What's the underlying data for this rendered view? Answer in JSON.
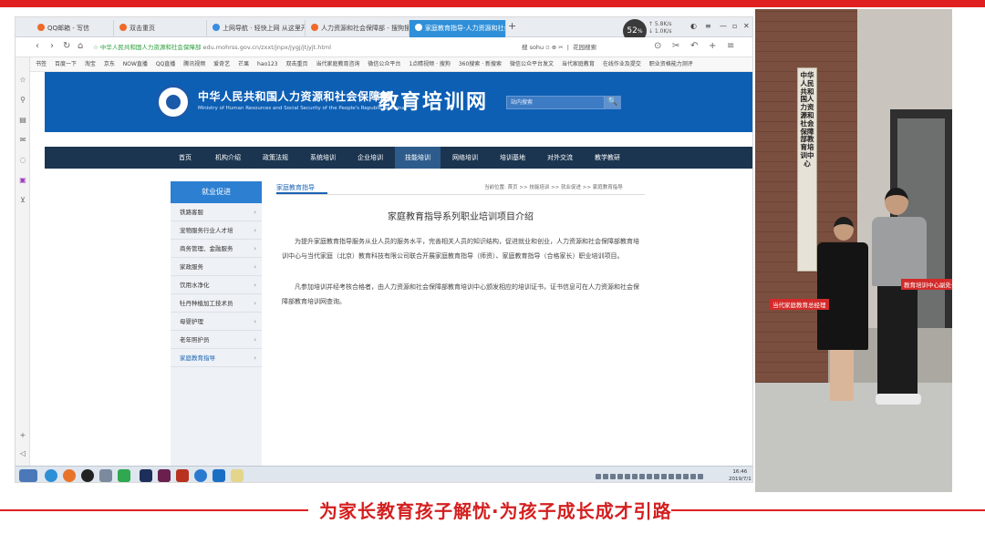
{
  "browser": {
    "tabs": [
      {
        "label": "QQ邮箱 - 写信",
        "active": false
      },
      {
        "label": "双击重页",
        "active": false
      },
      {
        "label": "上网导航 · 轻快上网 从这里开始",
        "active": false
      },
      {
        "label": "人力资源和社会保障部 - 搜狗搜索",
        "active": false
      },
      {
        "label": "家庭教育指导-人力资源和社会保障部 ×",
        "active": true
      }
    ],
    "new_tab": "+",
    "speed_value": "52",
    "speed_unit": "%",
    "speed_up": "↑ 5.8K/s",
    "speed_down": "↓ 1.0K/s",
    "url_prefix": "中华人民共和国人力资源和社会保障部",
    "url": "edu.mohrss.gov.cn/zxxt/jnpx/jygj/jtjyjt.html",
    "search_mini": "搜 sohu",
    "search_engine": "花园搜索",
    "bookmarks": [
      "书签",
      "百度一下",
      "淘宝",
      "京东",
      "NOW直播",
      "QQ直播",
      "腾讯视频",
      "爱奇艺",
      "芒果",
      "hao123",
      "双击重页",
      "当代家庭教育咨询",
      "微信公众平台",
      "1点睛视频 · 搜狗",
      "360搜索 · 新搜索",
      "微信公众平台发文",
      "当代家庭教育",
      "在线作业及提交",
      "职业资格能力测评"
    ]
  },
  "site": {
    "title": "中华人民共和国人力资源和社会保障部",
    "subtitle": "Ministry of Human Resources and Social Security of the People's Republic of China",
    "brand": "教育培训网",
    "search_placeholder": "站内搜索",
    "search_button": "🔍",
    "nav": [
      "首页",
      "机构介绍",
      "政策法规",
      "系统培训",
      "企业培训",
      "技能培训",
      "网络培训",
      "培训基地",
      "对外交流",
      "教学教研"
    ],
    "nav_active_index": 5
  },
  "sidebar": {
    "heading": "就业促进",
    "items": [
      "铁路客服",
      "宠物服务行业人才培",
      "商务管理、金融服务",
      "家政服务",
      "饮用水净化",
      "牡丹种植加工技术员",
      "母婴护理",
      "老年照护员",
      "家庭教育指导"
    ],
    "active_index": 8
  },
  "article": {
    "tab_label": "家庭教育指导",
    "breadcrumb": "当前位置: 首页 >> 技能培训 >> 就业促进 >> 家庭教育指导",
    "title": "家庭教育指导系列职业培训项目介绍",
    "paragraphs": [
      "为提升家庭教育指导服务从业人员的服务水平，完善相关人员的知识结构，促进就业和创业，人力资源和社会保障部教育培训中心与当代家庭（北京）教育科技有限公司联合开展家庭教育指导（师资）、家庭教育指导（合格家长）职业培训项目。",
      "凡参加培训并经考核合格者，由人力资源和社会保障部教育培训中心颁发相应的培训证书，证书信息可在人力资源和社会保障部教育培训网查询。"
    ]
  },
  "taskbar": {
    "time": "16:46",
    "date": "2019/7/1"
  },
  "photo": {
    "sign_text": "中华人民共和国人力资源和社会保障部教育培训中心",
    "label_left": "当代家庭教育总经理",
    "label_right": "教育培训中心副处长"
  },
  "slogan": "为家长教育孩子解忧·为孩子成长成才引路",
  "colors": {
    "accent_red": "#e02020",
    "site_blue": "#0d5fb4",
    "nav_dark": "#1b3550"
  }
}
